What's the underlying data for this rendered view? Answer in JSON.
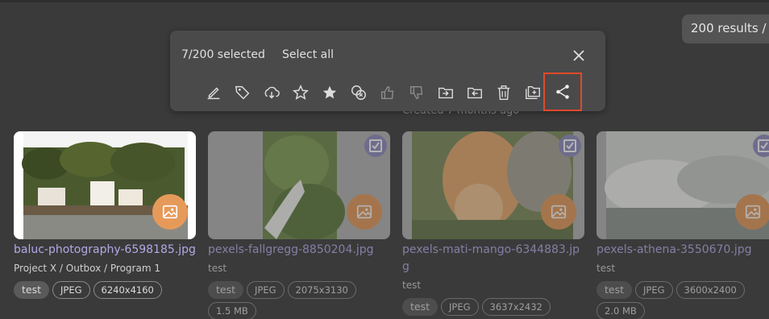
{
  "results_label": "200 results /",
  "created_label": "Created 7 months ago",
  "selection": {
    "count_label": "7/200 selected",
    "select_all_label": "Select all"
  },
  "toolbar_icons": [
    "edit-icon",
    "tag-icon",
    "download-icon",
    "star-outline-icon",
    "star-filled-icon",
    "compare-icon",
    "thumbs-up-icon",
    "thumbs-down-icon",
    "move-in-icon",
    "move-out-icon",
    "delete-icon",
    "add-to-folder-icon",
    "share-icon"
  ],
  "cards": [
    {
      "name": "baluc-photography-6598185.jpg",
      "path": "Project X / Outbox / Program 1",
      "selected": false,
      "chips": [
        "test",
        "JPEG",
        "6240x4160"
      ]
    },
    {
      "name": "pexels-fallgregg-8850204.jpg",
      "path": "test",
      "selected": true,
      "chips": [
        "test",
        "JPEG",
        "2075x3130",
        "1.5 MB"
      ]
    },
    {
      "name": "pexels-mati-mango-6344883.jpg",
      "path": "test",
      "selected": true,
      "chips": [
        "test",
        "JPEG",
        "3637x2432"
      ]
    },
    {
      "name": "pexels-athena-3550670.jpg",
      "path": "test",
      "selected": true,
      "chips": [
        "test",
        "JPEG",
        "3600x2400",
        "2.0 MB"
      ]
    }
  ],
  "colors": {
    "accent": "#b3a8e6",
    "badge": "#e69a5a",
    "highlight": "#e0492b"
  }
}
